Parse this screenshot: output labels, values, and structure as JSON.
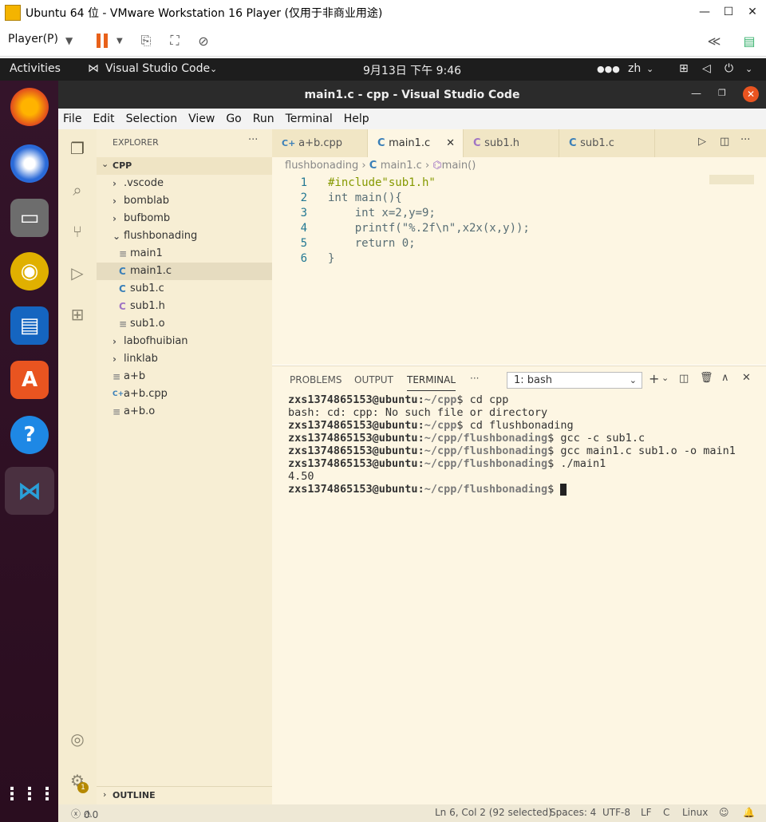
{
  "window": {
    "title": "Ubuntu 64 位 - VMware Workstation 16 Player (仅用于非商业用途)"
  },
  "vm_toolbar": {
    "player_menu": "Player(P)"
  },
  "gnome": {
    "activities": "Activities",
    "app": "Visual Studio Code",
    "clock": "9月13日  下午 9:46",
    "lang": "zh"
  },
  "vscode": {
    "title": "main1.c - cpp - Visual Studio Code",
    "menu": [
      "File",
      "Edit",
      "Selection",
      "View",
      "Go",
      "Run",
      "Terminal",
      "Help"
    ],
    "explorer_title": "EXPLORER",
    "folder": "CPP",
    "outline": "OUTLINE",
    "tree": [
      {
        "label": ".vscode",
        "type": "folder"
      },
      {
        "label": "bomblab",
        "type": "folder"
      },
      {
        "label": "bufbomb",
        "type": "folder"
      },
      {
        "label": "flushbonading",
        "type": "folder-open"
      },
      {
        "label": "main1",
        "type": "file"
      },
      {
        "label": "main1.c",
        "type": "c"
      },
      {
        "label": "sub1.c",
        "type": "c"
      },
      {
        "label": "sub1.h",
        "type": "h"
      },
      {
        "label": "sub1.o",
        "type": "file"
      },
      {
        "label": "labofhuibian",
        "type": "folder"
      },
      {
        "label": "linklab",
        "type": "folder"
      },
      {
        "label": "a+b",
        "type": "file"
      },
      {
        "label": "a+b.cpp",
        "type": "cpp"
      },
      {
        "label": "a+b.o",
        "type": "file"
      }
    ],
    "tabs": [
      {
        "label": "a+b.cpp",
        "icon": "C++"
      },
      {
        "label": "main1.c",
        "icon": "C"
      },
      {
        "label": "sub1.h",
        "icon": "C"
      },
      {
        "label": "sub1.c",
        "icon": "C"
      }
    ],
    "breadcrumb": {
      "folder": "flushbonading",
      "file": "main1.c",
      "symbol": "main()"
    },
    "code_lines": [
      {
        "n": "1",
        "text": "#include\"sub1.h\""
      },
      {
        "n": "2",
        "text": "int main(){"
      },
      {
        "n": "3",
        "text": "    int x=2,y=9;"
      },
      {
        "n": "4",
        "text": "    printf(\"%.2f\\n\",x2x(x,y));"
      },
      {
        "n": "5",
        "text": "    return 0;"
      },
      {
        "n": "6",
        "text": "}"
      }
    ],
    "panel_tabs": [
      "PROBLEMS",
      "OUTPUT",
      "TERMINAL"
    ],
    "terminal_select": "1: bash",
    "terminal": [
      {
        "prompt": "zxs1374865153@ubuntu",
        "path": "~/cpp",
        "cmd": " cd cpp"
      },
      {
        "out": "bash: cd: cpp: No such file or directory"
      },
      {
        "prompt": "zxs1374865153@ubuntu",
        "path": "~/cpp",
        "cmd": " cd flushbonading"
      },
      {
        "prompt": "zxs1374865153@ubuntu",
        "path": "~/cpp/flushbonading",
        "cmd": " gcc -c sub1.c"
      },
      {
        "prompt": "zxs1374865153@ubuntu",
        "path": "~/cpp/flushbonading",
        "cmd": " gcc main1.c sub1.o -o main1"
      },
      {
        "prompt": "zxs1374865153@ubuntu",
        "path": "~/cpp/flushbonading",
        "cmd": " ./main1"
      },
      {
        "out": "4.50"
      },
      {
        "prompt": "zxs1374865153@ubuntu",
        "path": "~/cpp/flushbonading",
        "cmd": " "
      }
    ],
    "status": {
      "problems": "0",
      "warnings": "0",
      "position": "Ln 6, Col 2 (92 selected)",
      "spaces": "Spaces: 4",
      "encoding": "UTF-8",
      "eol": "LF",
      "lang": "C",
      "os": "Linux"
    },
    "settings_badge": "1"
  }
}
